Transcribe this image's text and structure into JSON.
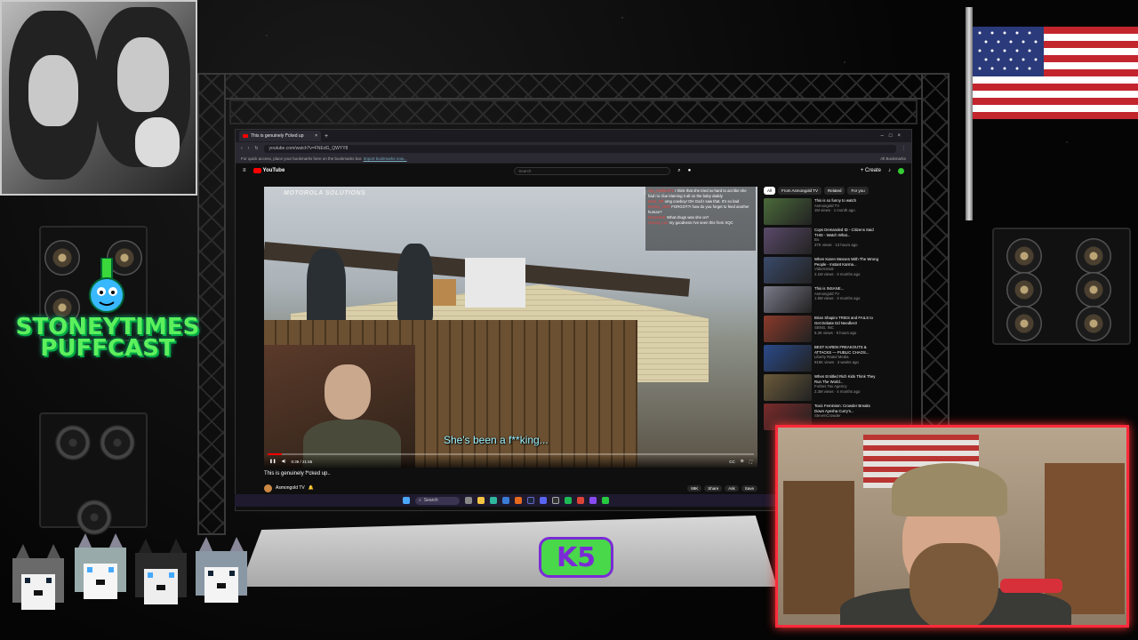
{
  "overlay": {
    "logo_text": "STONEYTIMES PUFFCAST",
    "badge_text": "K5",
    "badge_colors": {
      "fill": "#49d84a",
      "border": "#7b2bd6"
    },
    "webcam_border_color": "#ff2a3a"
  },
  "browser": {
    "tab_title": "This is genuinely f*cked up",
    "url": "youtube.com/watch?v=FNEdG_QWYY8",
    "bookmarks_hint": "For quick access, place your bookmarks here on the bookmarks bar.",
    "bookmarks_import": "Import bookmarks now...",
    "all_bookmarks": "All Bookmarks"
  },
  "youtube": {
    "logo": "YouTube",
    "search_placeholder": "Search",
    "create_label": "Create",
    "video": {
      "watermark": "MOTOROLA SOLUTIONS",
      "timestamp": "03/16/2",
      "subtitle": "She's been a f**king...",
      "time_display": "0:39 / 21:55",
      "progress_fraction": 0.03,
      "title": "This is genuinely f*cked up..",
      "channel": "Asmongold TV"
    },
    "actions": [
      "69K",
      "Share",
      "Ask",
      "Save"
    ],
    "chat": [
      {
        "user": "Tay_Swiftie871",
        "text": "I think that she tried so hard to act like she had no clue blaming it all on the baby daddy"
      },
      {
        "user": "Bowl_Off",
        "text": "omg cowboy! OH God I saw that. It's so bad"
      },
      {
        "user": "Bootsy_1981",
        "text": "FORGOT?! how do you forget to feed another human?"
      },
      {
        "user": "Ravenfear",
        "text": "What drugs was she on?"
      },
      {
        "user": "Hotrod_Lee",
        "text": "my goodness I've seen this from XQC"
      }
    ],
    "sidebar_chips": [
      "All",
      "From Asmongold TV",
      "Related",
      "For you"
    ],
    "recommended": [
      {
        "title": "This is so funny to watch",
        "channel": "Asmongold TV",
        "views": "1M views · 1 month ago",
        "color": "#4a6a3a"
      },
      {
        "title": "Cops Demanded ID - Citizens Said THIS - Watch What...",
        "channel": "Bo",
        "views": "37K views · 13 hours ago",
        "color": "#5a4a6a"
      },
      {
        "title": "When Karen Messes With The Wrong People - Instant Karma...",
        "channel": "VidsAnimal",
        "views": "2.1M views · 3 months ago",
        "color": "#3a4a6a"
      },
      {
        "title": "This is INSANE...",
        "channel": "Asmongold TV",
        "views": "1.5M views · 3 months ago",
        "color": "#7a7a8a"
      },
      {
        "title": "Brian Shapiro TRIES and FAILS to Get Debate Dd Needles!!",
        "channel": "SBNG, INC",
        "views": "5.2K views · 9 hours ago",
        "color": "#8a3a2a"
      },
      {
        "title": "BEST KAREN FREAKOUTS & ATTACKS — PUBLIC CHAOS...",
        "channel": "Liberty Rated Media",
        "views": "910K views · 3 weeks ago",
        "color": "#2a4a8a"
      },
      {
        "title": "When Entitled Rich Kids Think They Run The World...",
        "channel": "Forbes Tax Agency",
        "views": "2.3M views · 4 months ago",
        "color": "#6a5a3a"
      },
      {
        "title": "Toxic Feminism: Crowder Breaks Down Ayesha Curry's...",
        "channel": "StevenCrowder",
        "views": "",
        "color": "#7a2a2a"
      }
    ]
  },
  "taskbar": {
    "search_label": "Search"
  }
}
